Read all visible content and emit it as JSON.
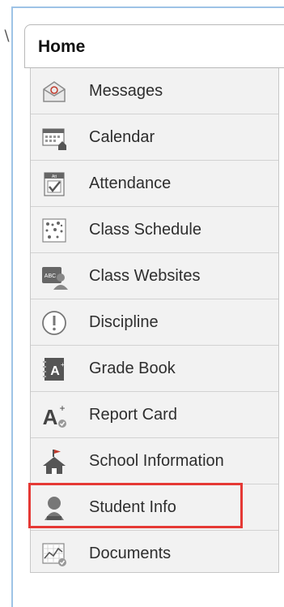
{
  "home": {
    "label": "Home"
  },
  "menu": {
    "items": [
      {
        "label": "Messages",
        "icon": "envelope-icon"
      },
      {
        "label": "Calendar",
        "icon": "calendar-icon"
      },
      {
        "label": "Attendance",
        "icon": "attendance-icon"
      },
      {
        "label": "Class Schedule",
        "icon": "schedule-icon"
      },
      {
        "label": "Class Websites",
        "icon": "website-icon"
      },
      {
        "label": "Discipline",
        "icon": "alert-icon"
      },
      {
        "label": "Grade Book",
        "icon": "gradebook-icon"
      },
      {
        "label": "Report Card",
        "icon": "report-card-icon"
      },
      {
        "label": "School Information",
        "icon": "school-icon"
      },
      {
        "label": "Student Info",
        "icon": "student-icon"
      },
      {
        "label": "Documents",
        "icon": "documents-icon"
      }
    ]
  },
  "colors": {
    "highlight": "#e53935",
    "menu_bg": "#f2f2f2",
    "frame": "#9ec3e6"
  }
}
